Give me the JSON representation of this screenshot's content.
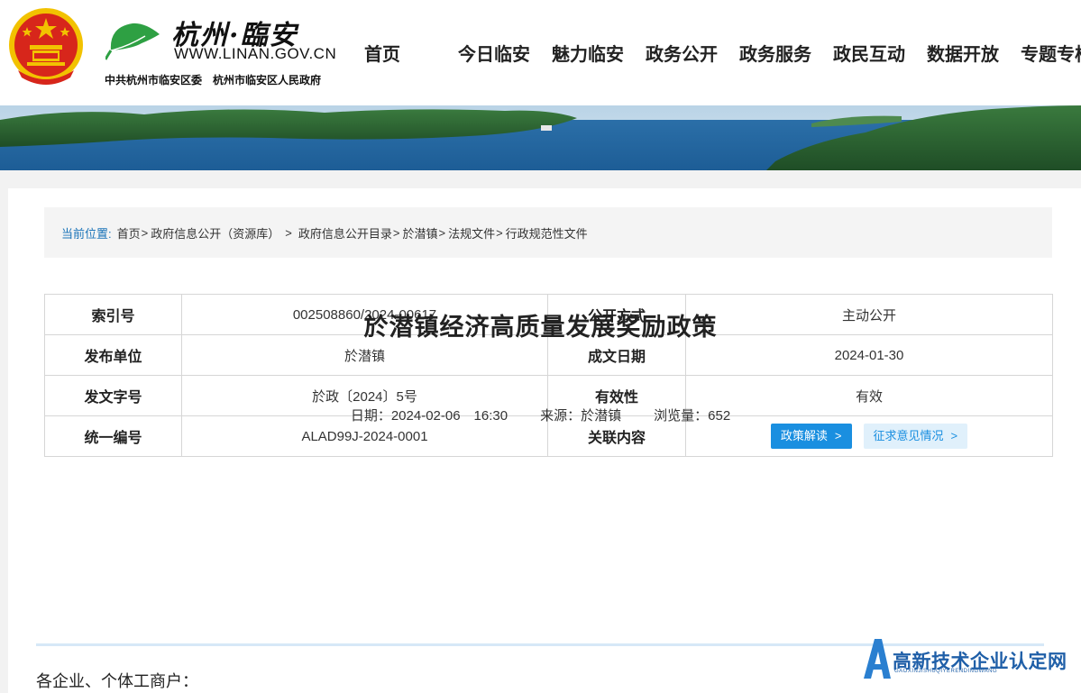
{
  "header": {
    "brand_cn": "杭州·臨安",
    "brand_url": "WWW.LINAN.GOV.CN",
    "brand_sub": "中共杭州市临安区委　杭州市临安区人民政府"
  },
  "nav": {
    "items": [
      {
        "label": "首页"
      },
      {
        "label": "今日临安"
      },
      {
        "label": "魅力临安"
      },
      {
        "label": "政务公开"
      },
      {
        "label": "政务服务"
      },
      {
        "label": "政民互动"
      },
      {
        "label": "数据开放"
      },
      {
        "label": "专题专栏"
      }
    ]
  },
  "breadcrumb": {
    "prefix": "当前位置:",
    "items": [
      {
        "label": "首页"
      },
      {
        "label": "政府信息公开（资源库）"
      },
      {
        "label": "政府信息公开目录"
      },
      {
        "label": "於潜镇"
      },
      {
        "label": "法规文件"
      },
      {
        "label": "行政规范性文件"
      }
    ],
    "separator": ">"
  },
  "meta": {
    "rows": [
      {
        "l1": "索引号",
        "v1": "002508860/2024-00617",
        "l2": "公开方式",
        "v2": "主动公开"
      },
      {
        "l1": "发布单位",
        "v1": "於潜镇",
        "l2": "成文日期",
        "v2": "2024-01-30"
      },
      {
        "l1": "发文字号",
        "v1": "於政〔2024〕5号",
        "l2": "有效性",
        "v2": "有效"
      },
      {
        "l1": "统一编号",
        "v1": "ALAD99J-2024-0001",
        "l2": "关联内容",
        "v2": ""
      }
    ],
    "btn_interpret": "政策解读",
    "btn_opinion": "征求意见情况",
    "arrow": ">"
  },
  "document": {
    "title": "於潜镇经济高质量发展奖励政策",
    "date_label": "日期：",
    "date_value": "2024-02-06　16:30",
    "source_label": "来源：",
    "source_value": "於潜镇",
    "views_label": "浏览量：",
    "views_value": "652",
    "body_first_line": "各企业、个体工商户："
  },
  "watermark": {
    "text": "高新技术企业认定网",
    "sub": "GAOXINJISHUQIYERENDINGWANG"
  },
  "colors": {
    "accent": "#1a8fe0",
    "breadcrumb_prefix": "#1a73b8",
    "emblem_red": "#d7261b",
    "emblem_gold": "#f2c200"
  }
}
